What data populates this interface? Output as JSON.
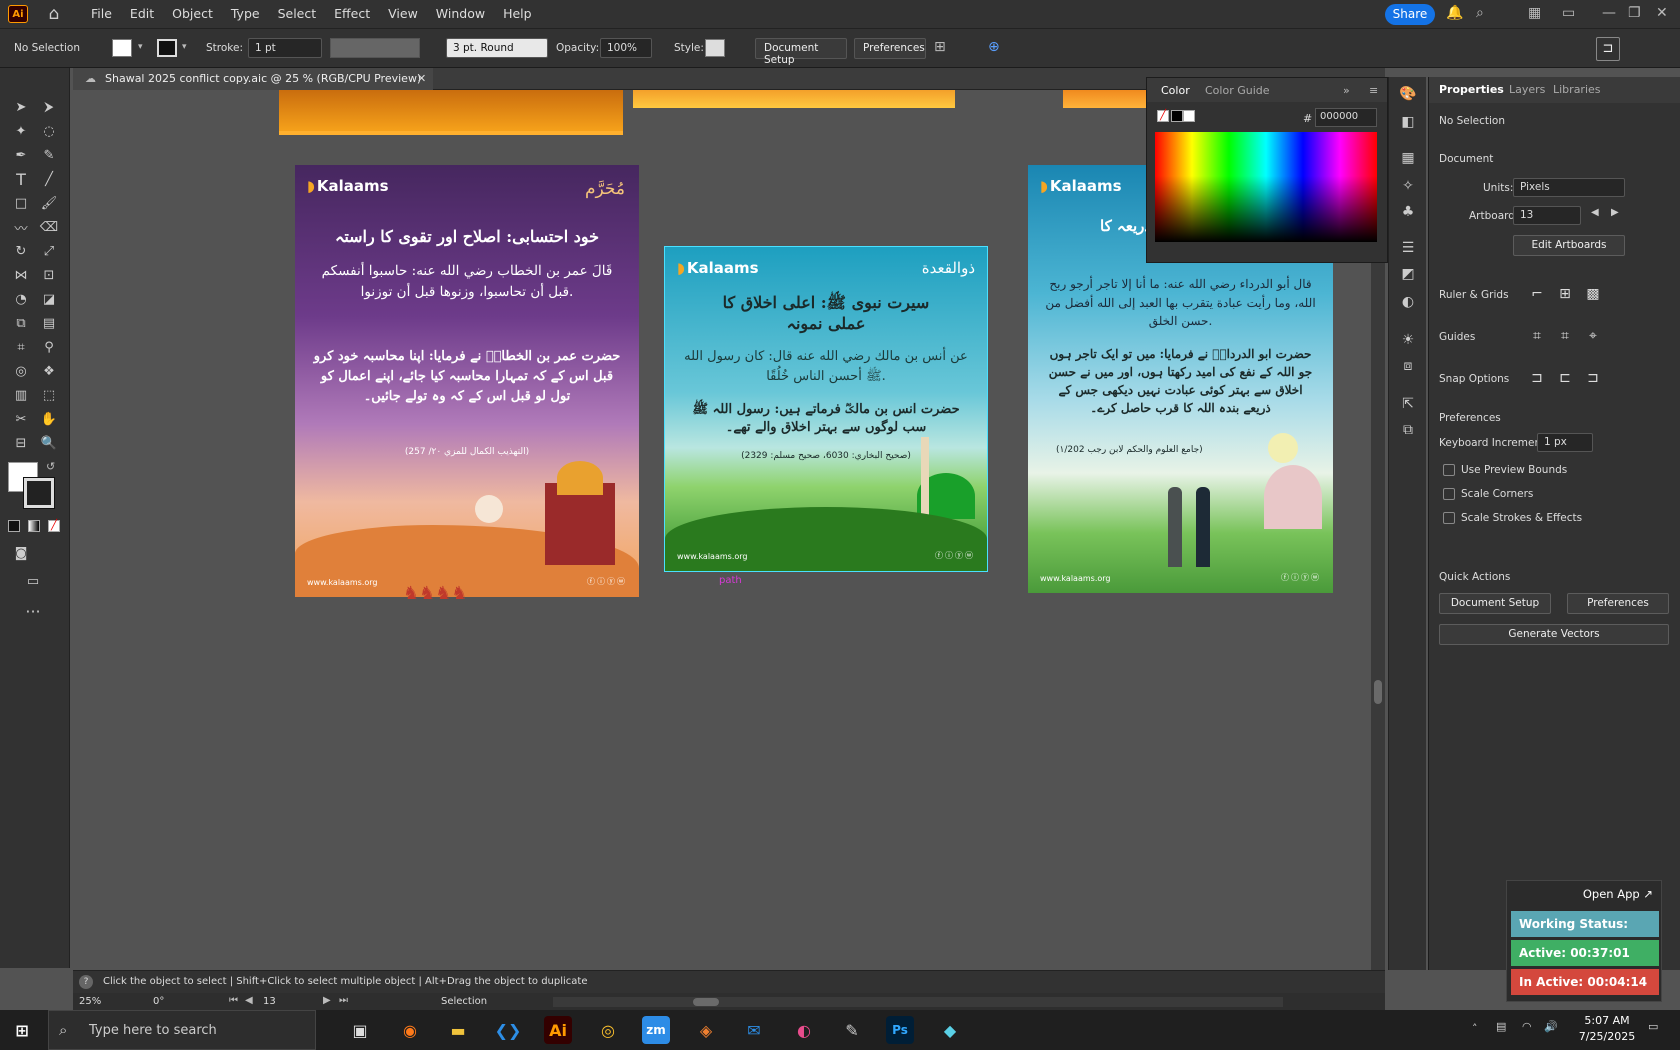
{
  "menubar": {
    "logo": "Ai",
    "items": [
      "File",
      "Edit",
      "Object",
      "Type",
      "Select",
      "Effect",
      "View",
      "Window",
      "Help"
    ],
    "share_label": "Share"
  },
  "control_bar": {
    "selection": "No Selection",
    "stroke_label": "Stroke:",
    "stroke_value": "1 pt",
    "brush": "3 pt. Round",
    "opacity_label": "Opacity:",
    "opacity_value": "100%",
    "style_label": "Style:",
    "document_setup": "Document Setup",
    "preferences": "Preferences"
  },
  "tab": {
    "title": "Shawal 2025 conflict copy.aic @ 25 % (RGB/CPU Preview)",
    "close": "✕"
  },
  "artboards": [
    {
      "logo": "Kalaams",
      "month": "مُحَرَّم",
      "title": "خود احتسابی: اصلاح اور تقوی کا راستہ",
      "arabic": "قَالَ عمر بن الخطاب رضي الله عنه: حاسبوا أنفسكم قبل أن تحاسبوا، وزنوها قبل أن توزنوا.",
      "urdu": "حضرت عمر بن الخطابؓ نے فرمایا: اپنا محاسبہ خود کرو قبل اس کے کہ تمہارا محاسبہ کیا جائے، اپنے اعمال کو تول لو قبل اس کے کہ وہ تولے جائیں۔",
      "ref": "(التهذيب الكمال للمزي ٢٠/ 257)",
      "url": "www.kalaams.org"
    },
    {
      "logo": "Kalaams",
      "month": "ذوالقعدة",
      "title": "سیرت نبوی ﷺ: اعلی اخلاق کا عملی نمونہ",
      "arabic": "عن أنس بن مالك رضي الله عنه قال: كان رسول الله ﷺ أحسن الناس خُلُقًا.",
      "urdu": "حضرت انس بن مالکؓ فرماتے ہیں: رسول اللہ ﷺ سب لوگوں سے بہتر اخلاق والے تھے۔",
      "ref": "(صحيح البخاري: 6030، صحيح مسلم: 2329)",
      "url": "www.kalaams.org",
      "path_label": "path"
    },
    {
      "logo": "Kalaams",
      "title": "ذریعہ کا",
      "arabic": "قال أبو الدرداء رضي الله عنه: ما أنا إلا تاجر أرجو ربح الله، وما رأيت عبادة يتقرب بها العبد إلى الله أفضل من حسن الخلق.",
      "urdu": "حضرت ابو الدرداءؓ نے فرمایا: میں تو ایک تاجر ہوں جو اللہ کے نفع کی امید رکھتا ہوں، اور میں نے حسن اخلاق سے بہتر کوئی عبادت نہیں دیکھی جس کے ذریعے بندہ اللہ کا قرب حاصل کرے۔",
      "ref": "(جامع العلوم والحكم لابن رجب ١/202)",
      "url": "www.kalaams.org"
    }
  ],
  "color_panel": {
    "tab1": "Color",
    "tab2": "Color Guide",
    "hex_label": "#",
    "hex": "000000"
  },
  "properties": {
    "tabs": [
      "Properties",
      "Layers",
      "Libraries"
    ],
    "selection": "No Selection",
    "document": "Document",
    "units_label": "Units:",
    "units_value": "Pixels",
    "artboard_label": "Artboard:",
    "artboard_value": "13",
    "edit_artboards": "Edit Artboards",
    "ruler_grids": "Ruler & Grids",
    "guides": "Guides",
    "snap_options": "Snap Options",
    "preferences": "Preferences",
    "keyboard_increment_label": "Keyboard Increment:",
    "keyboard_increment": "1 px",
    "use_preview_bounds": "Use Preview Bounds",
    "scale_corners": "Scale Corners",
    "scale_strokes": "Scale Strokes & Effects",
    "quick_actions": "Quick Actions",
    "document_setup": "Document Setup",
    "preferences_btn": "Preferences",
    "generate_vectors": "Generate Vectors"
  },
  "status": {
    "hint": "Click the object to select  |  Shift+Click to select multiple object  |  Alt+Drag the object to duplicate",
    "zoom": "25%",
    "rotate": "0°",
    "artboard": "13",
    "tool": "Selection"
  },
  "work_tracker": {
    "open_app": "Open App ↗",
    "status": "Working Status: Active",
    "active": "Active: 00:37:01",
    "inactive": "In Active: 00:04:14"
  },
  "taskbar": {
    "search": "Type here to search",
    "time": "5:07 AM",
    "date": "7/25/2025"
  }
}
